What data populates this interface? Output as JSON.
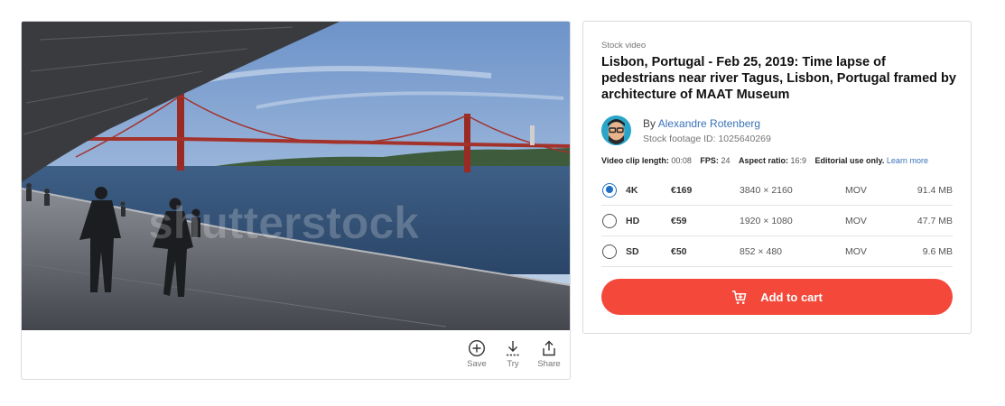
{
  "media": {
    "watermark": "shutterstock",
    "actions": [
      {
        "id": "save",
        "label": "Save",
        "icon": "plus-circle-icon"
      },
      {
        "id": "try",
        "label": "Try",
        "icon": "download-icon"
      },
      {
        "id": "share",
        "label": "Share",
        "icon": "share-icon"
      }
    ]
  },
  "details": {
    "eyebrow": "Stock video",
    "title": "Lisbon, Portugal - Feb 25, 2019: Time lapse of pedestrians near river Tagus, Lisbon, Portugal framed by architecture of MAAT Museum",
    "author": {
      "prefix": "By",
      "name": "Alexandre Rotenberg",
      "footage_id": "Stock footage ID: 1025640269"
    },
    "specs": {
      "clip_length_label": "Video clip length:",
      "clip_length": "00:08",
      "fps_label": "FPS:",
      "fps": "24",
      "aspect_label": "Aspect ratio:",
      "aspect": "16:9",
      "editorial": "Editorial use only.",
      "learn_more": "Learn more"
    },
    "options": [
      {
        "label": "4K",
        "price": "€169",
        "resolution": "3840 × 2160",
        "format": "MOV",
        "size": "91.4 MB",
        "selected": true
      },
      {
        "label": "HD",
        "price": "€59",
        "resolution": "1920 × 1080",
        "format": "MOV",
        "size": "47.7 MB",
        "selected": false
      },
      {
        "label": "SD",
        "price": "€50",
        "resolution": "852 × 480",
        "format": "MOV",
        "size": "9.6 MB",
        "selected": false
      }
    ],
    "cart_label": "Add to cart"
  },
  "colors": {
    "accent": "#f4483a",
    "link": "#3a72b8",
    "radio": "#1f6fc6"
  }
}
